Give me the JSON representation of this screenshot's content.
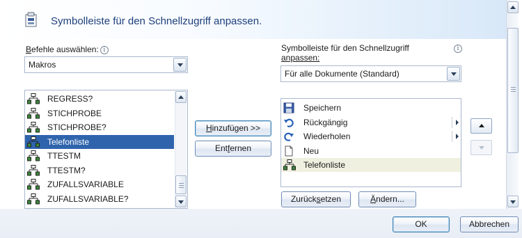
{
  "dialog": {
    "title": "Symbolleiste für den Schnellzugriff anpassen."
  },
  "left": {
    "commands_label_prefix": "B",
    "commands_label_rest": "efehle auswählen:",
    "info_glyph": "i",
    "category_value": "Makros",
    "items": [
      {
        "label": "REGRESS?",
        "icon": "macro-icon"
      },
      {
        "label": "STICHPROBE",
        "icon": "macro-icon"
      },
      {
        "label": "STICHPROBE?",
        "icon": "macro-icon"
      },
      {
        "label": "Telefonliste",
        "icon": "macro-icon",
        "selected": true
      },
      {
        "label": "TTESTM",
        "icon": "macro-icon"
      },
      {
        "label": "TTESTM?",
        "icon": "macro-icon"
      },
      {
        "label": "ZUFALLSVARIABLE",
        "icon": "macro-icon"
      },
      {
        "label": "ZUFALLSVARIABLE?",
        "icon": "macro-icon"
      }
    ]
  },
  "middle": {
    "add_before": "",
    "add_u": "H",
    "add_after": "inzufügen >>",
    "remove_before": "Ent",
    "remove_u": "f",
    "remove_after": "ernen"
  },
  "right": {
    "toolbar_label_line1": "Symbolleiste für den Schnellzugriff",
    "toolbar_label_line2": "anpassen:",
    "info_glyph": "i",
    "scope_value": "Für alle Dokumente (Standard)",
    "items": [
      {
        "label": "Speichern",
        "icon": "save-icon"
      },
      {
        "label": "Rückgängig",
        "icon": "undo-icon",
        "submenu": true
      },
      {
        "label": "Wiederholen",
        "icon": "redo-icon",
        "submenu": true
      },
      {
        "label": "Neu",
        "icon": "new-document-icon"
      },
      {
        "label": "Telefonliste",
        "icon": "macro-icon",
        "highlighted": true
      }
    ],
    "reset_before": "Zurück",
    "reset_u": "s",
    "reset_after": "etzen",
    "modify_before": "",
    "modify_u": "Ä",
    "modify_after": "ndern..."
  },
  "footer": {
    "ok_label": "OK",
    "cancel_label": "Abbrechen"
  },
  "colors": {
    "selection": "#2f64ad",
    "title_text": "#1e3f7a",
    "highlight_row": "#f0f0e0"
  }
}
